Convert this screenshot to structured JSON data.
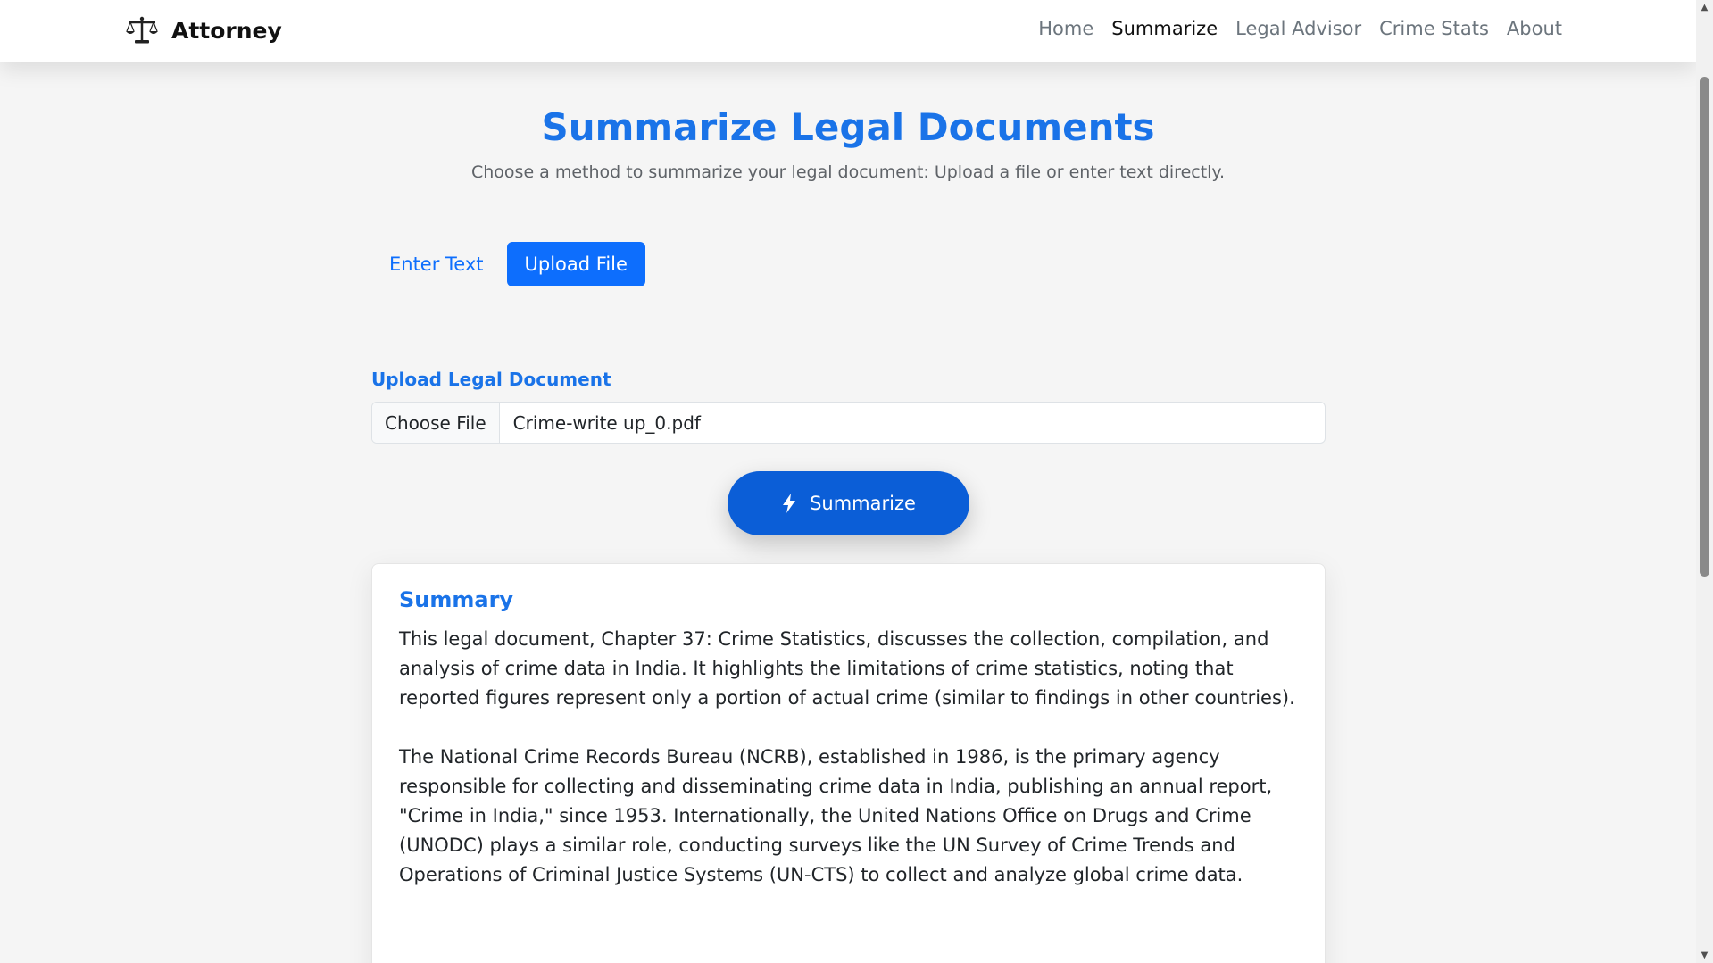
{
  "navbar": {
    "brand": "Attorney",
    "links": [
      {
        "label": "Home",
        "active": false
      },
      {
        "label": "Summarize",
        "active": true
      },
      {
        "label": "Legal Advisor",
        "active": false
      },
      {
        "label": "Crime Stats",
        "active": false
      },
      {
        "label": "About",
        "active": false
      }
    ]
  },
  "header": {
    "title": "Summarize Legal Documents",
    "subtitle": "Choose a method to summarize your legal document: Upload a file or enter text directly."
  },
  "tabs": [
    {
      "label": "Enter Text",
      "active": false
    },
    {
      "label": "Upload File",
      "active": true
    }
  ],
  "upload": {
    "label": "Upload Legal Document",
    "button_label": "Choose File",
    "file_name": "Crime-write up_0.pdf"
  },
  "actions": {
    "summarize_label": "Summarize"
  },
  "summary": {
    "title": "Summary",
    "paragraphs": [
      "This legal document, Chapter 37: Crime Statistics, discusses the collection, compilation, and analysis of crime data in India. It highlights the limitations of crime statistics, noting that reported figures represent only a portion of actual crime (similar to findings in other countries).",
      "The National Crime Records Bureau (NCRB), established in 1986, is the primary agency responsible for collecting and disseminating crime data in India, publishing an annual report, \"Crime in India,\" since 1953. Internationally, the United Nations Office on Drugs and Crime (UNODC) plays a similar role, conducting surveys like the UN Survey of Crime Trends and Operations of Criminal Justice Systems (UN-CTS) to collect and analyze global crime data."
    ]
  },
  "colors": {
    "accent": "#1a73e8",
    "primary_button": "#0d6efd",
    "summarize_button": "#0b5ed7",
    "background": "#f5f5f5"
  },
  "icons": {
    "brand": "scales-of-justice-icon",
    "summarize": "lightning-bolt-icon"
  }
}
